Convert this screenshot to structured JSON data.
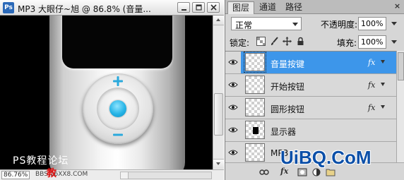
{
  "document_window": {
    "app_icon_text": "Ps",
    "title": "MP3 大眼仔~旭 @ 86.8% (音量...",
    "watermark_text": "PS教程论坛",
    "status": {
      "zoom": "86.76%",
      "url_text": "BBS.16XX8.COM",
      "red_mark": "教"
    }
  },
  "panel": {
    "tabs": [
      {
        "label": "图层",
        "active": true
      },
      {
        "label": "通道",
        "active": false
      },
      {
        "label": "路径",
        "active": false
      }
    ],
    "close_glyph": "×",
    "blend_mode": "正常",
    "opacity_label": "不透明度:",
    "opacity_value": "100%",
    "lock_label": "锁定:",
    "fill_label": "填充:",
    "fill_value": "100%",
    "layers": [
      {
        "name": "音量按键",
        "selected": true,
        "fx": "fx",
        "thumb": "checker"
      },
      {
        "name": "开始按钮",
        "selected": false,
        "fx": "fx",
        "thumb": "checker"
      },
      {
        "name": "圆形按钮",
        "selected": false,
        "fx": "fx",
        "thumb": "checker"
      },
      {
        "name": "显示器",
        "selected": false,
        "fx": "",
        "thumb": "black-rect"
      },
      {
        "name": "MP3",
        "selected": false,
        "fx": "",
        "thumb": "checker"
      }
    ],
    "bottom_fx_label": "fx"
  },
  "brand_watermark": "UiBQ.CoM",
  "colors": {
    "selected_layer": "#3d96ea",
    "center_button": "#26b4e6",
    "brand": "#0b4fa8"
  }
}
